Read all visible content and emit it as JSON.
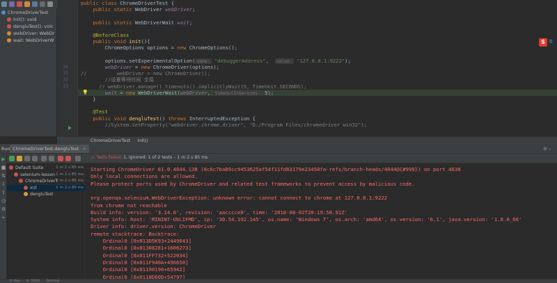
{
  "structure": {
    "items": [
      {
        "label": "ChromeDriverTest",
        "icon": "class-icon",
        "color": "#4a8fd8"
      },
      {
        "label": "init(): void",
        "icon": "method-icon",
        "color": "#c75450"
      },
      {
        "label": "dengluTest(): voic",
        "icon": "method-icon",
        "color": "#c75450"
      },
      {
        "label": "webDriver: WebDr",
        "icon": "field-icon",
        "color": "#d08a3a"
      },
      {
        "label": "wait: WebDriverW",
        "icon": "field-icon",
        "color": "#d08a3a"
      }
    ]
  },
  "editor": {
    "line_numbers": [
      "",
      "",
      "",
      "",
      "",
      "",
      "",
      "",
      "",
      "",
      "30",
      "31",
      "32",
      "33",
      "",
      "",
      "",
      "",
      "",
      "",
      ""
    ],
    "lines": [
      [
        {
          "c": "kw",
          "t": "public class "
        },
        {
          "c": "",
          "t": "ChromeDriverTest {"
        }
      ],
      [
        {
          "c": "",
          "t": "    "
        },
        {
          "c": "kw",
          "t": "public static "
        },
        {
          "c": "",
          "t": "WebDriver "
        },
        {
          "c": "fld",
          "t": "webDriver"
        },
        {
          "c": "",
          "t": ";"
        }
      ],
      [
        {
          "c": "",
          "t": ""
        }
      ],
      [
        {
          "c": "",
          "t": "    "
        },
        {
          "c": "kw",
          "t": "public static "
        },
        {
          "c": "",
          "t": "WebDriverWait "
        },
        {
          "c": "fld",
          "t": "wait"
        },
        {
          "c": "",
          "t": ";"
        }
      ],
      [
        {
          "c": "",
          "t": ""
        }
      ],
      [
        {
          "c": "",
          "t": "    "
        },
        {
          "c": "ann",
          "t": "@BeforeClass"
        }
      ],
      [
        {
          "c": "",
          "t": "    "
        },
        {
          "c": "kw",
          "t": "public void "
        },
        {
          "c": "fn",
          "t": "init"
        },
        {
          "c": "",
          "t": "(){"
        }
      ],
      [
        {
          "c": "",
          "t": "        ChromeOptions options = "
        },
        {
          "c": "kw",
          "t": "new "
        },
        {
          "c": "",
          "t": "ChromeOptions();"
        }
      ],
      [
        {
          "c": "",
          "t": ""
        }
      ],
      [
        {
          "c": "",
          "t": "        options.setExperimentalOption("
        },
        {
          "c": "hint",
          "t": "name:"
        },
        {
          "c": "",
          "t": " "
        },
        {
          "c": "str",
          "t": "\"debuggerAddress\""
        },
        {
          "c": "",
          "t": ",  "
        },
        {
          "c": "hint",
          "t": "value:"
        },
        {
          "c": "",
          "t": " "
        },
        {
          "c": "str",
          "t": "\"127.0.0.1:9222\""
        },
        {
          "c": "",
          "t": ");"
        }
      ],
      [
        {
          "c": "",
          "t": "        "
        },
        {
          "c": "fld",
          "t": "webDriver"
        },
        {
          "c": "",
          "t": " = "
        },
        {
          "c": "kw",
          "t": "new "
        },
        {
          "c": "",
          "t": "ChromeDriver(options);"
        }
      ],
      [
        {
          "c": "cmt",
          "t": "//          webDriver = new ChromeDriver();"
        }
      ],
      [
        {
          "c": "cmt",
          "t": "        //设置等待时间 全局"
        }
      ],
      [
        {
          "c": "cmt",
          "t": "      // webDriver.manage().timeouts().implicitlyWait(5, TimeUnit.SECONDS);"
        }
      ],
      [
        {
          "c": "",
          "t": "        "
        },
        {
          "c": "fld",
          "t": "wait"
        },
        {
          "c": "",
          "t": " = "
        },
        {
          "c": "kw",
          "t": "new "
        },
        {
          "c": "",
          "t": "WebDriverWait("
        },
        {
          "c": "fld",
          "t": "webDriver"
        },
        {
          "c": "",
          "t": ", "
        },
        {
          "c": "hint",
          "t": "timeOutInSeconds:"
        },
        {
          "c": "",
          "t": " 5);"
        }
      ],
      [
        {
          "c": "",
          "t": "    }"
        }
      ],
      [
        {
          "c": "",
          "t": ""
        }
      ],
      [
        {
          "c": "",
          "t": "    "
        },
        {
          "c": "ann",
          "t": "@Test"
        }
      ],
      [
        {
          "c": "",
          "t": "    "
        },
        {
          "c": "kw",
          "t": "public void "
        },
        {
          "c": "fn",
          "t": "dengluTest"
        },
        {
          "c": "",
          "t": "() "
        },
        {
          "c": "kw",
          "t": "throws "
        },
        {
          "c": "",
          "t": "InterruptedException {"
        }
      ],
      [
        {
          "c": "cmt",
          "t": "        //System.setProperty(\"webdriver.chrome.driver\", \"D:/Program Files/chromedriver win32\");"
        }
      ]
    ]
  },
  "breadcrumb": [
    "ChromeDriverTest",
    "init()"
  ],
  "run_window": {
    "label": "Run:",
    "tab": "ChromeDriverTest.dengluTest",
    "status_prefix": "Tests failed:",
    "status_counts": "1, ignored: 1 of 2 tests – 1 m 2 s 85 ms",
    "tree": [
      {
        "label": "Default Suite",
        "duration": "1 m 2 s 85 ms",
        "indent": 0,
        "status": "fail"
      },
      {
        "label": "selenium-lesson",
        "duration": "1 m 2 s 85 ms",
        "indent": 1,
        "status": "fail"
      },
      {
        "label": "ChromeDriverT",
        "duration": "1 m 2 s 85 ms",
        "indent": 2,
        "status": "fail"
      },
      {
        "label": "init",
        "duration": "1 m 2 s 85 ms",
        "indent": 3,
        "status": "fail",
        "selected": true
      },
      {
        "label": "dengluTest",
        "duration": "",
        "indent": 3,
        "status": "ignored"
      }
    ],
    "console": [
      "Starting ChromeDriver 81.0.4044.138 (8c6c7ba89cc9453625af54f11fd83179e23450fa-refs/branch-heads/4044@{#999}) on port 4638",
      "Only local connections are allowed.",
      "Please protect ports used by ChromeDriver and related test frameworks to prevent access by malicious code.",
      "",
      "org.openqa.selenium.WebDriverException: unknown error: cannot connect to chrome at 127.0.0.1:9222",
      "from chrome not reachable",
      "Build info: version: '3.14.0', revision: 'aacccce0', time: '2018-08-02T20:19:58.91Z'",
      "System info: host: 'MININT-U6LIFMD', ip: '30.54.192.145', os.name: 'Windows 7', os.arch: 'amd64', os.version: '6.1', java.version: '1.8.0_66'",
      "Driver info: driver.version: ChromeDriver",
      "remote stacktrace: Backtrace:",
      "    Ordinal0 [0x013D5K93+2449043]",
      "    Ordinal0 [0x01308281+1606273]",
      "    Ordinal0 [0x011FF732+522034]",
      "    Ordinal0 [0x011F940A+496650]",
      "    Ordinal0 [0x01190196+65942]",
      "    Ordinal0 [0x0118D60D+54797]"
    ]
  },
  "bottom_bar": [
    "4: Run",
    "6: TODO",
    "Terminal"
  ],
  "colors": {
    "accent_error": "#ff6b68",
    "editor_bg": "#2b2b2b",
    "panel_bg": "#3c3f41"
  }
}
